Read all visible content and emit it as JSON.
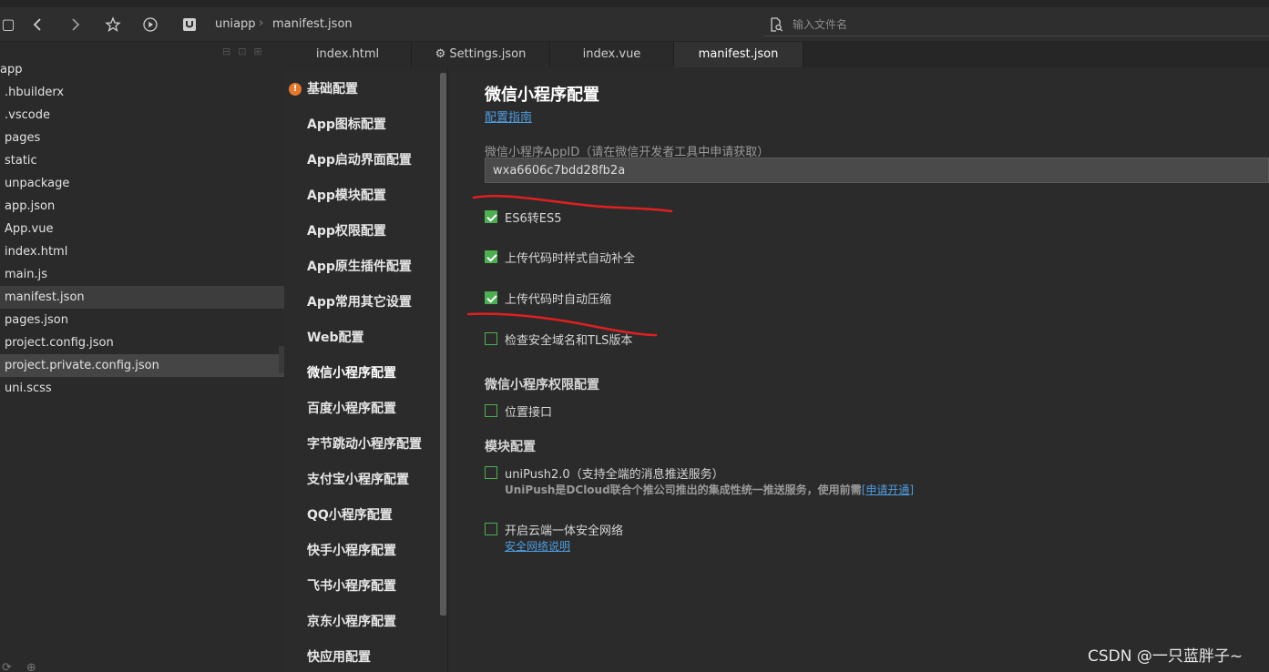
{
  "toolbar": {
    "breadcrumb": [
      "uniapp",
      "manifest.json"
    ],
    "file_search_placeholder": "输入文件名",
    "icons": [
      "new-file-icon",
      "back-icon",
      "forward-icon",
      "star-icon",
      "play-icon",
      "project-icon",
      "search-file-icon"
    ]
  },
  "file_tree": {
    "items": [
      {
        "label": "app"
      },
      {
        "label": ".hbuilderx"
      },
      {
        "label": ".vscode"
      },
      {
        "label": "pages"
      },
      {
        "label": "static"
      },
      {
        "label": "unpackage"
      },
      {
        "label": "app.json"
      },
      {
        "label": "App.vue"
      },
      {
        "label": "index.html"
      },
      {
        "label": "main.js"
      },
      {
        "label": "manifest.json",
        "state": "active"
      },
      {
        "label": "pages.json"
      },
      {
        "label": "project.config.json"
      },
      {
        "label": "project.private.config.json",
        "state": "hover"
      },
      {
        "label": "uni.scss"
      }
    ]
  },
  "tabs": [
    {
      "label": "index.html"
    },
    {
      "label": "Settings.json",
      "icon": "gear-icon"
    },
    {
      "label": "index.vue"
    },
    {
      "label": "manifest.json",
      "active": true
    }
  ],
  "settings_nav": {
    "items": [
      {
        "label": "基础配置",
        "warning": true
      },
      {
        "label": "App图标配置"
      },
      {
        "label": "App启动界面配置"
      },
      {
        "label": "App模块配置"
      },
      {
        "label": "App权限配置"
      },
      {
        "label": "App原生插件配置"
      },
      {
        "label": "App常用其它设置"
      },
      {
        "label": "Web配置"
      },
      {
        "label": "微信小程序配置",
        "active": true
      },
      {
        "label": "百度小程序配置"
      },
      {
        "label": "字节跳动小程序配置"
      },
      {
        "label": "支付宝小程序配置"
      },
      {
        "label": "QQ小程序配置"
      },
      {
        "label": "快手小程序配置"
      },
      {
        "label": "飞书小程序配置"
      },
      {
        "label": "京东小程序配置"
      },
      {
        "label": "快应用配置"
      }
    ]
  },
  "content": {
    "title": "微信小程序配置",
    "guide_link": "配置指南",
    "appid_label": "微信小程序AppID（请在微信开发者工具中申请获取）",
    "appid_value": "wxa6606c7bdd28fb2a",
    "options": [
      {
        "label": "ES6转ES5",
        "checked": true
      },
      {
        "label": "上传代码时样式自动补全",
        "checked": true
      },
      {
        "label": "上传代码时自动压缩",
        "checked": true
      },
      {
        "label": "检查安全域名和TLS版本",
        "checked": false
      }
    ],
    "permission_heading": "微信小程序权限配置",
    "permissions": [
      {
        "label": "位置接口",
        "checked": false
      }
    ],
    "module_heading": "模块配置",
    "modules": [
      {
        "label": "uniPush2.0（支持全端的消息推送服务）",
        "checked": false,
        "note_bold": "UniPush是DCloud联合个推公司推出的集成性统一推送服务，使用前需",
        "note_link": "[申请开通]"
      },
      {
        "label": "开启云端一体安全网络",
        "checked": false,
        "sub_link": "安全网络说明"
      }
    ]
  },
  "watermark": "CSDN @一只蓝胖子~",
  "colors": {
    "accent_green": "#4caf50",
    "link_blue": "#4d9de0",
    "warning_orange": "#e8772a",
    "annotation_red": "#e02020"
  }
}
